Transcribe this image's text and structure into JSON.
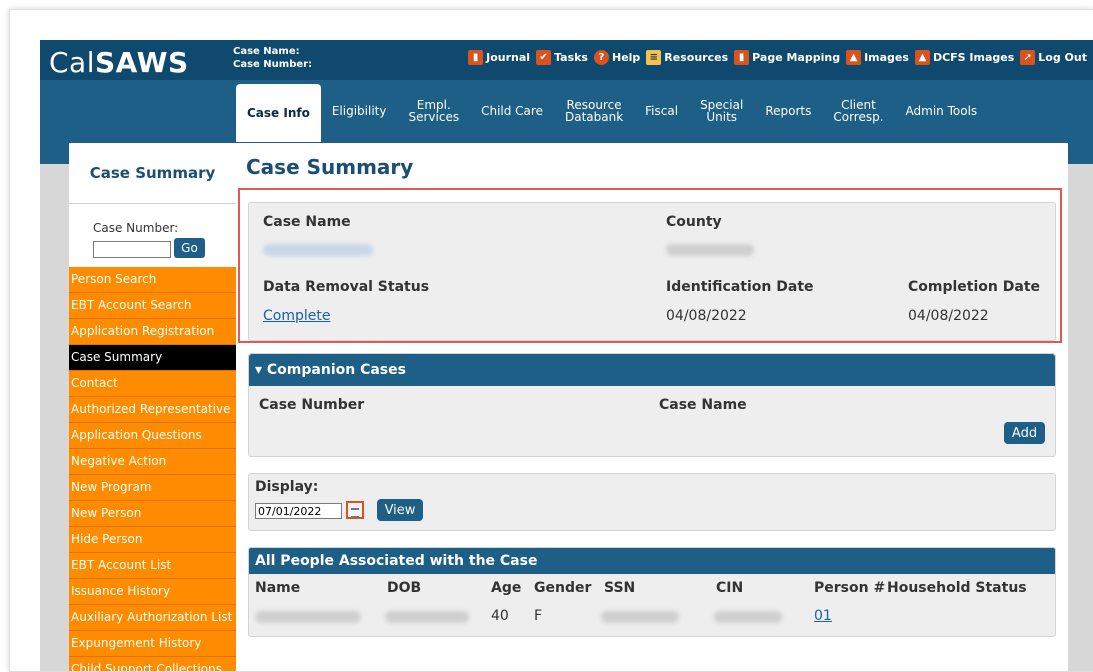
{
  "header": {
    "logo": {
      "regular": "Cal",
      "bold": "SAWS"
    },
    "case_name_label": "Case Name:",
    "case_number_label": "Case Number:",
    "links": [
      {
        "label": "Journal",
        "icon": "journal-icon"
      },
      {
        "label": "Tasks",
        "icon": "tasks-icon"
      },
      {
        "label": "Help",
        "icon": "help-icon"
      },
      {
        "label": "Resources",
        "icon": "resources-icon"
      },
      {
        "label": "Page Mapping",
        "icon": "page-mapping-icon"
      },
      {
        "label": "Images",
        "icon": "images-icon"
      },
      {
        "label": "DCFS Images",
        "icon": "dcfs-images-icon"
      },
      {
        "label": "Log Out",
        "icon": "log-out-icon"
      }
    ]
  },
  "nav": {
    "tabs": [
      {
        "line1": "Case Info",
        "line2": "",
        "active": true
      },
      {
        "line1": "Eligibility",
        "line2": ""
      },
      {
        "line1": "Empl.",
        "line2": "Services"
      },
      {
        "line1": "Child Care",
        "line2": ""
      },
      {
        "line1": "Resource",
        "line2": "Databank"
      },
      {
        "line1": "Fiscal",
        "line2": ""
      },
      {
        "line1": "Special",
        "line2": "Units"
      },
      {
        "line1": "Reports",
        "line2": ""
      },
      {
        "line1": "Client",
        "line2": "Corresp."
      },
      {
        "line1": "Admin Tools",
        "line2": ""
      }
    ]
  },
  "sidebar": {
    "title": "Case Summary",
    "case_number_label": "Case Number:",
    "go_label": "Go",
    "items": [
      "Person Search",
      "EBT Account Search",
      "Application Registration",
      "Case Summary",
      "Contact",
      "Authorized Representative",
      "Application Questions",
      "Negative Action",
      "New Program",
      "New Person",
      "Hide Person",
      "EBT Account List",
      "Issuance History",
      "Auxiliary Authorization List",
      "Expungement History",
      "Child Support Collections"
    ],
    "active_index": 3
  },
  "main": {
    "title": "Case Summary",
    "info": {
      "case_name_label": "Case Name",
      "county_label": "County",
      "data_removal_label": "Data Removal Status",
      "data_removal_value": "Complete",
      "identification_date_label": "Identification Date",
      "identification_date_value": "04/08/2022",
      "completion_date_label": "Completion Date",
      "completion_date_value": "04/08/2022"
    },
    "companion": {
      "title": "▾ Companion Cases",
      "col_case_number": "Case Number",
      "col_case_name": "Case Name",
      "add_label": "Add"
    },
    "display": {
      "label": "Display:",
      "date": "07/01/2022",
      "view_label": "View"
    },
    "people": {
      "title": "All People Associated with the Case",
      "columns": [
        "Name",
        "DOB",
        "Age",
        "Gender",
        "SSN",
        "CIN",
        "Person #",
        "Household Status"
      ],
      "row": {
        "age": "40",
        "gender": "F",
        "person_number": "01"
      }
    }
  },
  "colors": {
    "header_dark": "#0f4a6e",
    "nav_blue": "#1d5f87",
    "menu_orange": "#ff8c00",
    "highlight_red": "#e05a58",
    "link_blue": "#1b5fa8"
  }
}
